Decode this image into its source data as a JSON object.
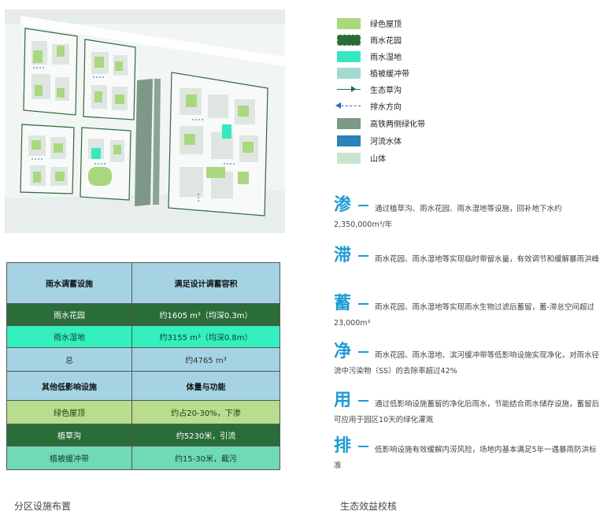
{
  "legend": [
    {
      "icon": "green-roof-swatch",
      "label": "绿色屋顶",
      "color": "#a9d87f",
      "kind": "fill"
    },
    {
      "icon": "rain-garden-swatch",
      "label": "雨水花园",
      "color": "#2b6d39",
      "kind": "fill"
    },
    {
      "icon": "rain-wetland-swatch",
      "label": "雨水湿地",
      "color": "#36e8c2",
      "kind": "fill"
    },
    {
      "icon": "vegetated-buffer-swatch",
      "label": "植被缓冲带",
      "color": "#a6d8d2",
      "kind": "fill"
    },
    {
      "icon": "ecological-swale-icon",
      "label": "生态草沟",
      "color": "#2f6a3a",
      "kind": "line"
    },
    {
      "icon": "drainage-direction-icon",
      "label": "排水方向",
      "color": "#2a6cc8",
      "kind": "arrow"
    },
    {
      "icon": "rail-greenbelt-swatch",
      "label": "高铁两侧绿化带",
      "color": "#7e9887",
      "kind": "fill"
    },
    {
      "icon": "river-water-swatch",
      "label": "河流水体",
      "color": "#2a84b8",
      "kind": "fill"
    },
    {
      "icon": "mountain-swatch",
      "label": "山体",
      "color": "#c8e6cf",
      "kind": "fill"
    }
  ],
  "table": {
    "header1": [
      "雨水调蓄设施",
      "满足设计调蓄容积"
    ],
    "rows1": [
      {
        "name": "雨水花园",
        "value": "约1605 m³（均深0.3m）",
        "style": "dark"
      },
      {
        "name": "雨水湿地",
        "value": "约3155 m³（均深0.8m）",
        "style": "mint"
      },
      {
        "name": "总",
        "value": "约4765 m³",
        "style": "blue"
      }
    ],
    "header2": [
      "其他低影响设施",
      "体量与功能"
    ],
    "rows2": [
      {
        "name": "绿色屋顶",
        "value": "约占20-30%，下渗",
        "style": "lime"
      },
      {
        "name": "植草沟",
        "value": "约5230米，引流",
        "style": "dark"
      },
      {
        "name": "植被缓冲带",
        "value": "约15-30米，截污",
        "style": "teal"
      }
    ]
  },
  "benefits": [
    {
      "char": "渗",
      "text": "通过植草沟、雨水花园、雨水湿地等设施，回补地下水约2,350,000m³/年"
    },
    {
      "char": "滞",
      "text": "雨水花园、雨水湿地等实现临时带留水量，有效调节和缓解暴雨洪峰"
    },
    {
      "char": "蓄",
      "text": "雨水花园、雨水湿地等实现雨水生物过滤后蓄留，蓄-滞总空间超过23,000m³"
    },
    {
      "char": "净",
      "text": "雨水花园、雨水湿地、滨河缓冲带等低影响设施实现净化，对雨水径流中污染物（SS）的去除率超过42%"
    },
    {
      "char": "用",
      "text": "通过低影响设施蓄留的净化后雨水，节能结合雨水储存设施，蓄留后可应用于园区10天的绿化灌溉"
    },
    {
      "char": "排",
      "text": "低影响设施有效缓解内涝风险，场地内基本满足5年一遇暴雨防洪标准"
    }
  ],
  "captions": {
    "left": "分区设施布置",
    "right": "生态效益校核"
  }
}
